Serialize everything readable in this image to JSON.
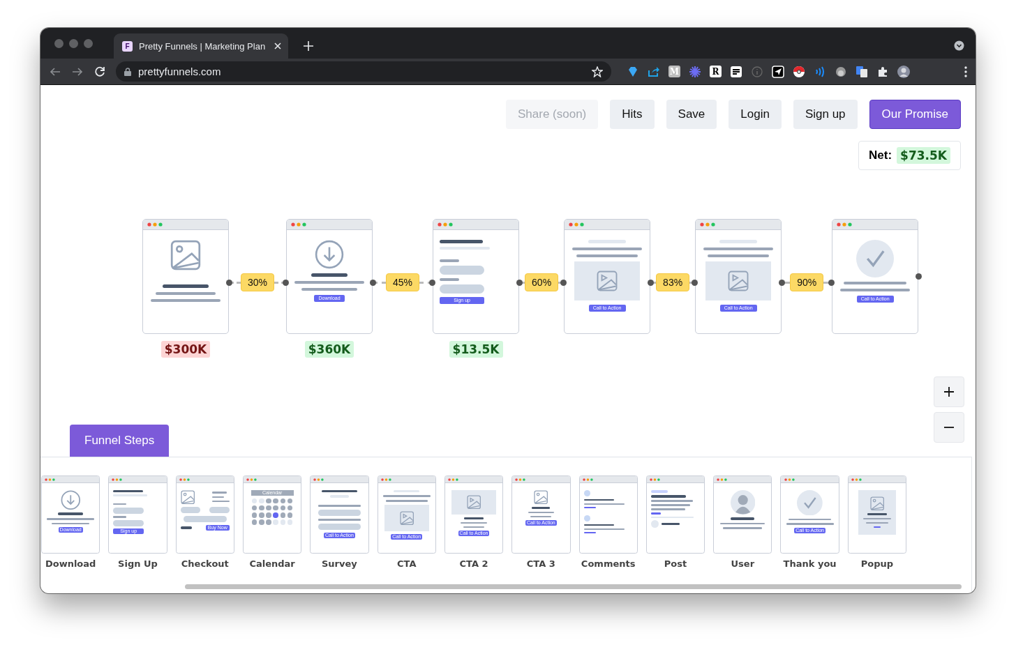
{
  "browser": {
    "tab": {
      "favicon": "F",
      "title": "Pretty Funnels | Marketing Plan"
    },
    "url": "prettyfunnels.com",
    "extensions": [
      {
        "kind": "gem"
      },
      {
        "kind": "share"
      },
      {
        "kind": "letter-grey",
        "text": "M"
      },
      {
        "kind": "burst"
      },
      {
        "kind": "letter-white",
        "text": "R"
      },
      {
        "kind": "lines"
      },
      {
        "kind": "info"
      },
      {
        "kind": "send"
      },
      {
        "kind": "ball"
      },
      {
        "kind": "waves"
      },
      {
        "kind": "monkey"
      },
      {
        "kind": "translate"
      },
      {
        "kind": "puzzle"
      },
      {
        "kind": "avatar"
      }
    ]
  },
  "header_buttons": [
    {
      "label": "Share (soon)",
      "kind": "disabled"
    },
    {
      "label": "Hits",
      "kind": "secondary"
    },
    {
      "label": "Save",
      "kind": "secondary"
    },
    {
      "label": "Login",
      "kind": "secondary"
    },
    {
      "label": "Sign up",
      "kind": "secondary"
    },
    {
      "label": "Our Promise",
      "kind": "primary"
    }
  ],
  "net": {
    "label": "Net:",
    "value": "$73.5K",
    "color": "#d3f7dc"
  },
  "funnel": {
    "nodes": [
      {
        "kind": "image",
        "revenue": {
          "text": "$300K",
          "color": "#fdd5d5"
        }
      },
      {
        "kind": "download",
        "button": "Download",
        "revenue": {
          "text": "$360K",
          "color": "#d3f7dc"
        }
      },
      {
        "kind": "signup",
        "button": "Sign up",
        "revenue": {
          "text": "$13.5K",
          "color": "#d3f7dc"
        }
      },
      {
        "kind": "cta",
        "button": "Call to Action"
      },
      {
        "kind": "cta",
        "button": "Call to Action"
      },
      {
        "kind": "thanks",
        "button": "Call to Action"
      }
    ],
    "conversions": [
      "30%",
      "45%",
      "60%",
      "83%",
      "90%"
    ]
  },
  "steps_tab": {
    "label": "Funnel Steps",
    "selected": true
  },
  "steps": [
    {
      "kind": "download",
      "label": "Download",
      "button": "Download"
    },
    {
      "kind": "signup",
      "label": "Sign Up",
      "button": "Sign up"
    },
    {
      "kind": "checkout",
      "label": "Checkout",
      "button": "Buy Now"
    },
    {
      "kind": "calendar",
      "label": "Calendar",
      "button": "Calendar"
    },
    {
      "kind": "survey",
      "label": "Survey",
      "button": "Call to Action"
    },
    {
      "kind": "cta",
      "label": "CTA",
      "button": "Call to Action"
    },
    {
      "kind": "cta2",
      "label": "CTA 2",
      "button": "Call to Action"
    },
    {
      "kind": "cta3",
      "label": "CTA 3",
      "button": "Call to Action"
    },
    {
      "kind": "comments",
      "label": "Comments"
    },
    {
      "kind": "post",
      "label": "Post"
    },
    {
      "kind": "user",
      "label": "User"
    },
    {
      "kind": "thanks",
      "label": "Thank you",
      "button": "Call to Action"
    },
    {
      "kind": "popup",
      "label": "Popup"
    }
  ]
}
